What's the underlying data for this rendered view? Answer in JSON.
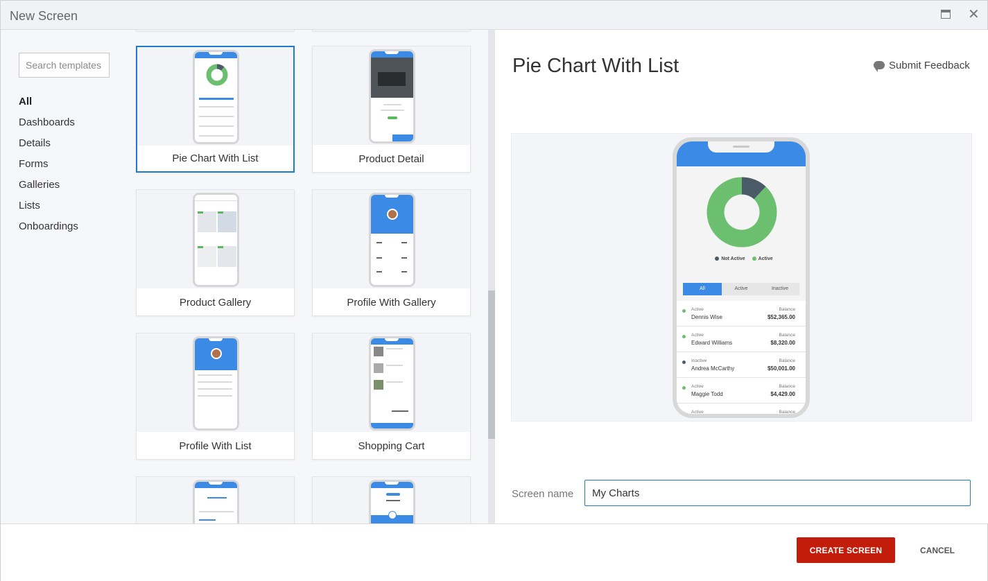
{
  "window": {
    "title": "New Screen"
  },
  "sidebar": {
    "search_placeholder": "Search templates",
    "categories": [
      {
        "label": "All",
        "active": true
      },
      {
        "label": "Dashboards"
      },
      {
        "label": "Details"
      },
      {
        "label": "Forms"
      },
      {
        "label": "Galleries"
      },
      {
        "label": "Lists"
      },
      {
        "label": "Onboardings"
      }
    ]
  },
  "templates": [
    {
      "label": "Pie Chart With List",
      "selected": true
    },
    {
      "label": "Product Detail"
    },
    {
      "label": "Product Gallery"
    },
    {
      "label": "Profile With Gallery"
    },
    {
      "label": "Profile With List"
    },
    {
      "label": "Shopping Cart"
    }
  ],
  "preview": {
    "title": "Pie Chart With List",
    "feedback_label": "Submit Feedback",
    "legend": [
      "Not Active",
      "Active"
    ],
    "chart_data": {
      "type": "pie",
      "labels": [
        "Not Active",
        "Active"
      ],
      "values": [
        12,
        88
      ],
      "colors": [
        "#4a5a66",
        "#6bbf6e"
      ]
    },
    "tabs": [
      "All",
      "Active",
      "Inactive"
    ],
    "balance_label": "Balance",
    "items": [
      {
        "status": "Active",
        "name": "Dennis Wise",
        "amount": "$52,365.00",
        "color": "#6bbf6e"
      },
      {
        "status": "Active",
        "name": "Edward Williams",
        "amount": "$8,320.00",
        "color": "#6bbf6e"
      },
      {
        "status": "Inactive",
        "name": "Andrea McCarthy",
        "amount": "$50,001.00",
        "color": "#4a5a66"
      },
      {
        "status": "Active",
        "name": "Maggie Todd",
        "amount": "$4,429.00",
        "color": "#6bbf6e"
      },
      {
        "status": "Active",
        "name": "",
        "amount": "",
        "color": "#6bbf6e"
      }
    ]
  },
  "screen_name": {
    "label": "Screen name",
    "value": "My Charts"
  },
  "footer": {
    "create_label": "CREATE SCREEN",
    "cancel_label": "CANCEL"
  },
  "colors": {
    "accent": "#1b7ccf",
    "primary_button": "#c21d0b",
    "phone_header": "#3b8ae6"
  }
}
